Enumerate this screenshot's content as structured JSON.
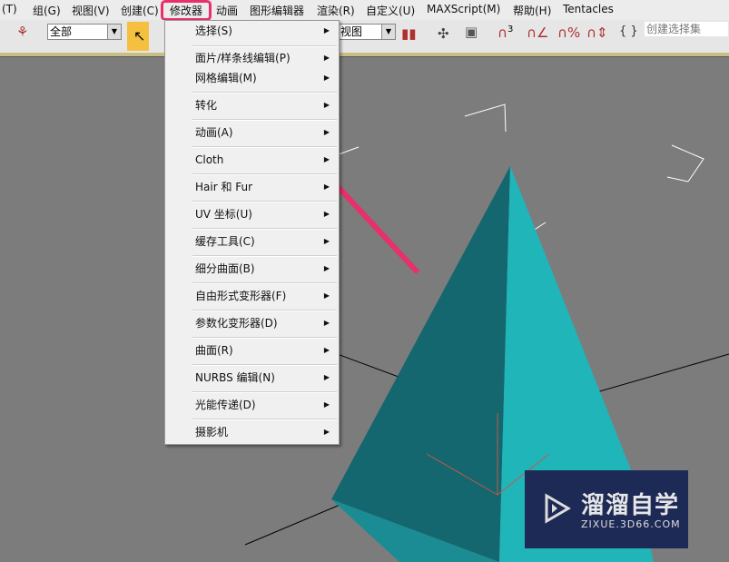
{
  "menubar": [
    "(T)",
    "组(G)",
    "视图(V)",
    "创建(C)",
    "修改器",
    "动画",
    "图形编辑器",
    "渲染(R)",
    "自定义(U)",
    "MAXScript(M)",
    "帮助(H)",
    "Tentacles"
  ],
  "toolbar": {
    "selection_filter": "全部",
    "view_dropdown": "视图",
    "named_selection_placeholder": "创建选择集",
    "snap_label": "3"
  },
  "modifiers_menu": {
    "items": [
      "选择(S)",
      "面片/样条线编辑(P)",
      "网格编辑(M)",
      "转化",
      "动画(A)",
      "Cloth",
      "Hair 和 Fur",
      "UV 坐标(U)",
      "缓存工具(C)",
      "细分曲面(B)",
      "自由形式变形器(F)",
      "参数化变形器(D)",
      "曲面(R)",
      "NURBS 编辑(N)",
      "光能传递(D)",
      "摄影机"
    ]
  },
  "watermark": {
    "title": "溜溜自学",
    "url": "ZIXUE.3D66.COM"
  },
  "colors": {
    "highlight": "#e8306a",
    "pyramid_dark": "#14676f",
    "pyramid_light": "#20b5b9",
    "viewport": "#7c7c7c"
  }
}
